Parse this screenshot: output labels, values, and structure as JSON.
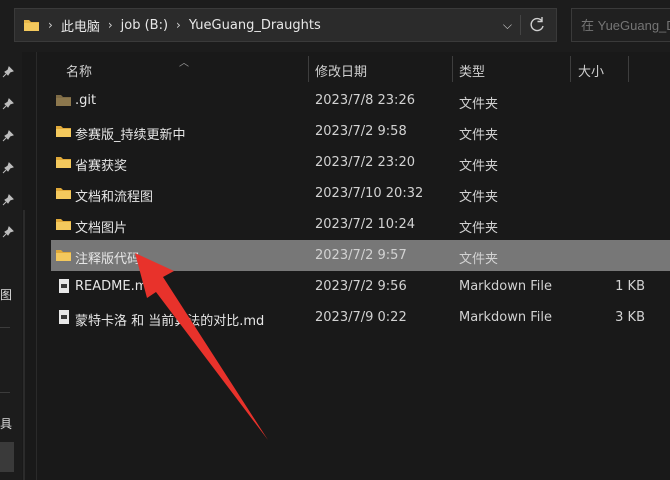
{
  "address_bar": {
    "crumbs": [
      "此电脑",
      "job (B:)",
      "YueGuang_Draughts"
    ],
    "icons": {
      "folder": "folder-icon",
      "dropdown": "chevron-down-icon",
      "refresh": "refresh-icon"
    }
  },
  "search": {
    "placeholder": "在 YueGuang_D"
  },
  "sidebar": {
    "pins": 6,
    "text_a": "图",
    "text_b": "具"
  },
  "columns": {
    "name": "名称",
    "modified": "修改日期",
    "type": "类型",
    "size": "大小"
  },
  "files": [
    {
      "name": ".git",
      "modified": "2023/7/8 23:26",
      "type": "文件夹",
      "size": "",
      "icon": "folder-dark-icon"
    },
    {
      "name": "参赛版_持续更新中",
      "modified": "2023/7/2 9:58",
      "type": "文件夹",
      "size": "",
      "icon": "folder-icon"
    },
    {
      "name": "省赛获奖",
      "modified": "2023/7/2 23:20",
      "type": "文件夹",
      "size": "",
      "icon": "folder-icon"
    },
    {
      "name": "文档和流程图",
      "modified": "2023/7/10 20:32",
      "type": "文件夹",
      "size": "",
      "icon": "folder-icon"
    },
    {
      "name": "文档图片",
      "modified": "2023/7/2 10:24",
      "type": "文件夹",
      "size": "",
      "icon": "folder-icon"
    },
    {
      "name": "注释版代码",
      "modified": "2023/7/2 9:57",
      "type": "文件夹",
      "size": "",
      "icon": "folder-icon",
      "selected": true
    },
    {
      "name": "README.md",
      "modified": "2023/7/2 9:56",
      "type": "Markdown File",
      "size": "1 KB",
      "icon": "markdown-file-icon"
    },
    {
      "name": "蒙特卡洛 和 当前算法的对比.md",
      "modified": "2023/7/9 0:22",
      "type": "Markdown File",
      "size": "3 KB",
      "icon": "markdown-file-icon"
    }
  ],
  "colors": {
    "selection": "#777777",
    "folder": "#e8b74a",
    "annotation_arrow": "#e8322b"
  }
}
